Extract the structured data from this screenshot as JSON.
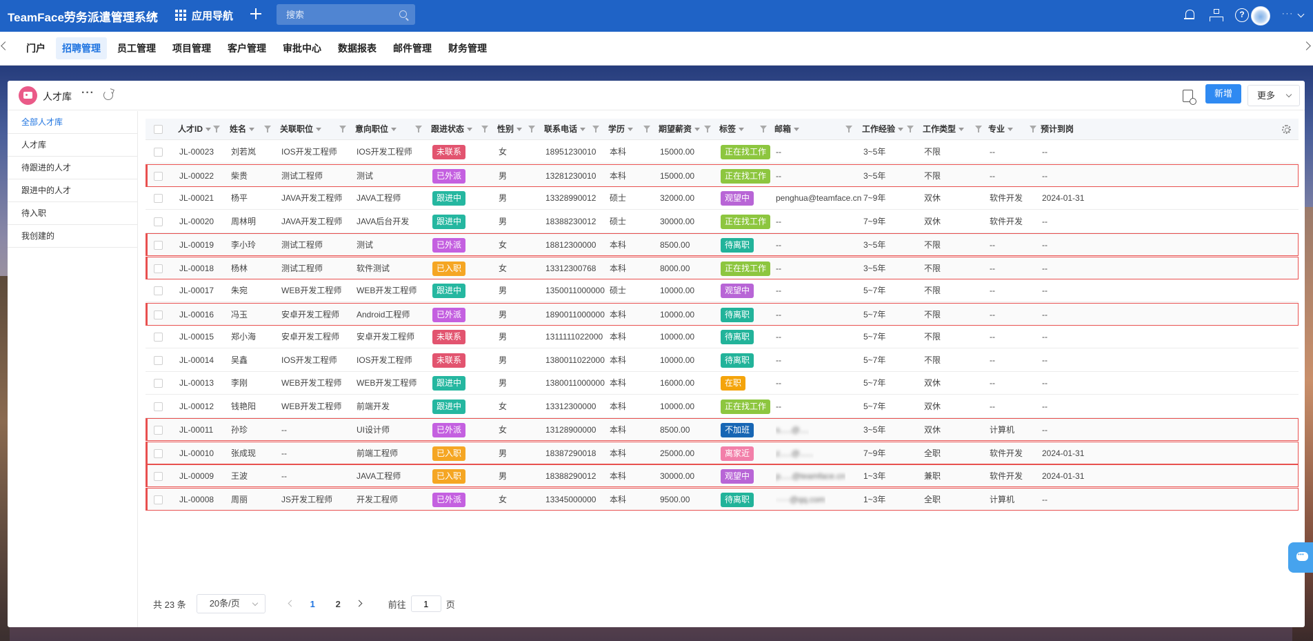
{
  "app": {
    "title": "TeamFace劳务派遣管理系统",
    "nav_label": "应用导航"
  },
  "search": {
    "placeholder": "搜索"
  },
  "user": {
    "name": "···"
  },
  "modules": [
    "门户",
    "招聘管理",
    "员工管理",
    "项目管理",
    "客户管理",
    "审批中心",
    "数据报表",
    "邮件管理",
    "财务管理"
  ],
  "active_module": "招聘管理",
  "page": {
    "title": "人才库",
    "new_label": "新增",
    "more_label": "更多"
  },
  "sidebar": [
    "全部人才库",
    "人才库",
    "待跟进的人才",
    "跟进中的人才",
    "待入职",
    "我创建的"
  ],
  "columns": [
    "人才ID",
    "姓名",
    "关联职位",
    "意向职位",
    "跟进状态",
    "性别",
    "联系电话",
    "学历",
    "期望薪资",
    "标签",
    "邮箱",
    "工作经验",
    "工作类型",
    "专业",
    "预计到岗"
  ],
  "status_colors": {
    "未联系": "#e2546f",
    "已外派": "#c460e0",
    "跟进中": "#25b7a0",
    "已入职": "#f5a623"
  },
  "tag_colors": {
    "正在找工作": "#8dc63f",
    "观望中": "#b865d6",
    "待离职": "#22b39a",
    "在职": "#f4a40b",
    "不加班": "#1766b4",
    "离家近": "#f27fa9"
  },
  "rows": [
    {
      "id": "JL-00023",
      "name": "刘若岚",
      "pos": "IOS开发工程师",
      "intent": "IOS开发工程师",
      "status": "未联系",
      "gender": "女",
      "phone": "18951230010",
      "edu": "本科",
      "salary": "15000.00",
      "tag": "正在找工作",
      "email": "--",
      "exp": "3~5年",
      "type": "不限",
      "major": "--",
      "date": "--",
      "hl": false
    },
    {
      "id": "JL-00022",
      "name": "柴贵",
      "pos": "测试工程师",
      "intent": "测试",
      "status": "已外派",
      "gender": "男",
      "phone": "13281230010",
      "edu": "本科",
      "salary": "15000.00",
      "tag": "正在找工作",
      "email": "--",
      "exp": "3~5年",
      "type": "不限",
      "major": "--",
      "date": "--",
      "hl": true
    },
    {
      "id": "JL-00021",
      "name": "杨平",
      "pos": "JAVA开发工程师",
      "intent": "JAVA工程师",
      "status": "跟进中",
      "gender": "男",
      "phone": "13328990012",
      "edu": "硕士",
      "salary": "32000.00",
      "tag": "观望中",
      "email": "penghua@teamface.cn",
      "exp": "7~9年",
      "type": "双休",
      "major": "软件开发",
      "date": "2024-01-31",
      "hl": false
    },
    {
      "id": "JL-00020",
      "name": "周林明",
      "pos": "JAVA开发工程师",
      "intent": "JAVA后台开发",
      "status": "跟进中",
      "gender": "男",
      "phone": "18388230012",
      "edu": "硕士",
      "salary": "30000.00",
      "tag": "正在找工作",
      "email": "--",
      "exp": "7~9年",
      "type": "双休",
      "major": "软件开发",
      "date": "--",
      "hl": false
    },
    {
      "id": "JL-00019",
      "name": "李小玲",
      "pos": "测试工程师",
      "intent": "测试",
      "status": "已外派",
      "gender": "女",
      "phone": "18812300000",
      "edu": "本科",
      "salary": "8500.00",
      "tag": "待离职",
      "email": "--",
      "exp": "3~5年",
      "type": "不限",
      "major": "--",
      "date": "--",
      "hl": true
    },
    {
      "id": "JL-00018",
      "name": "杨林",
      "pos": "测试工程师",
      "intent": "软件测试",
      "status": "已入职",
      "gender": "女",
      "phone": "13312300768",
      "edu": "本科",
      "salary": "8000.00",
      "tag": "正在找工作",
      "email": "--",
      "exp": "3~5年",
      "type": "不限",
      "major": "--",
      "date": "--",
      "hl": true
    },
    {
      "id": "JL-00017",
      "name": "朱宛",
      "pos": "WEB开发工程师",
      "intent": "WEB开发工程师",
      "status": "跟进中",
      "gender": "男",
      "phone": "1350011000000",
      "edu": "硕士",
      "salary": "10000.00",
      "tag": "观望中",
      "email": "--",
      "exp": "5~7年",
      "type": "不限",
      "major": "--",
      "date": "--",
      "hl": false
    },
    {
      "id": "JL-00016",
      "name": "冯玉",
      "pos": "安卓开发工程师",
      "intent": "Android工程师",
      "status": "已外派",
      "gender": "男",
      "phone": "1890011000000",
      "edu": "本科",
      "salary": "10000.00",
      "tag": "待离职",
      "email": "--",
      "exp": "5~7年",
      "type": "不限",
      "major": "--",
      "date": "--",
      "hl": true
    },
    {
      "id": "JL-00015",
      "name": "郑小海",
      "pos": "安卓开发工程师",
      "intent": "安卓开发工程师",
      "status": "未联系",
      "gender": "男",
      "phone": "1311111022000",
      "edu": "本科",
      "salary": "10000.00",
      "tag": "待离职",
      "email": "--",
      "exp": "5~7年",
      "type": "不限",
      "major": "--",
      "date": "--",
      "hl": false
    },
    {
      "id": "JL-00014",
      "name": "吴鑫",
      "pos": "IOS开发工程师",
      "intent": "IOS开发工程师",
      "status": "未联系",
      "gender": "男",
      "phone": "1380011022000",
      "edu": "本科",
      "salary": "10000.00",
      "tag": "待离职",
      "email": "--",
      "exp": "5~7年",
      "type": "不限",
      "major": "--",
      "date": "--",
      "hl": false
    },
    {
      "id": "JL-00013",
      "name": "李刚",
      "pos": "WEB开发工程师",
      "intent": "WEB开发工程师",
      "status": "跟进中",
      "gender": "男",
      "phone": "1380011000000",
      "edu": "本科",
      "salary": "16000.00",
      "tag": "在职",
      "email": "--",
      "exp": "5~7年",
      "type": "双休",
      "major": "--",
      "date": "--",
      "hl": false
    },
    {
      "id": "JL-00012",
      "name": "钱艳阳",
      "pos": "WEB开发工程师",
      "intent": "前端开发",
      "status": "跟进中",
      "gender": "女",
      "phone": "13312300000",
      "edu": "本科",
      "salary": "10000.00",
      "tag": "正在找工作",
      "email": "--",
      "exp": "5~7年",
      "type": "双休",
      "major": "--",
      "date": "--",
      "hl": false
    },
    {
      "id": "JL-00011",
      "name": "孙珍",
      "pos": "--",
      "intent": "UI设计师",
      "status": "已外派",
      "gender": "女",
      "phone": "13128900000",
      "edu": "本科",
      "salary": "8500.00",
      "tag": "不加班",
      "email": "s.....@....",
      "exp": "3~5年",
      "type": "双休",
      "major": "计算机",
      "date": "--",
      "hl": true,
      "blur": true
    },
    {
      "id": "JL-00010",
      "name": "张成现",
      "pos": "--",
      "intent": "前端工程师",
      "status": "已入职",
      "gender": "男",
      "phone": "18387290018",
      "edu": "本科",
      "salary": "25000.00",
      "tag": "离家近",
      "email": "z.....@......",
      "exp": "7~9年",
      "type": "全职",
      "major": "软件开发",
      "date": "2024-01-31",
      "hl": true,
      "blur": true
    },
    {
      "id": "JL-00009",
      "name": "王波",
      "pos": "--",
      "intent": "JAVA工程师",
      "status": "已入职",
      "gender": "男",
      "phone": "18388290012",
      "edu": "本科",
      "salary": "30000.00",
      "tag": "观望中",
      "email": "p.....@teamface.cn",
      "exp": "1~3年",
      "type": "兼职",
      "major": "软件开发",
      "date": "2024-01-31",
      "hl": true,
      "blur": true
    },
    {
      "id": "JL-00008",
      "name": "周丽",
      "pos": "JS开发工程师",
      "intent": "开发工程师",
      "status": "已外派",
      "gender": "女",
      "phone": "13345000000",
      "edu": "本科",
      "salary": "9500.00",
      "tag": "待离职",
      "email": "·····@qq.com",
      "exp": "1~3年",
      "type": "全职",
      "major": "计算机",
      "date": "--",
      "hl": true,
      "blur": true
    }
  ],
  "pagination": {
    "total": "共 23 条",
    "page_size": "20条/页",
    "pages": [
      "1",
      "2"
    ],
    "goto": "前往",
    "goto_value": "1",
    "unit": "页"
  }
}
